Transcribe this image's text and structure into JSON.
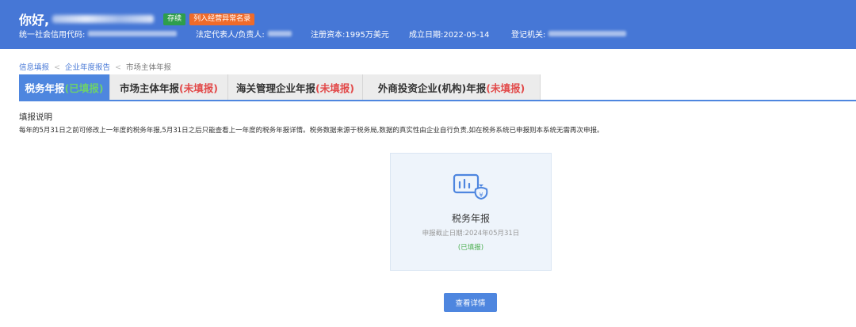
{
  "header": {
    "greeting": "你好,",
    "badges": {
      "status": "存续",
      "abnormal": "列入经营异常名录"
    },
    "credit_code_label": "统一社会信用代码:",
    "legal_rep_label": "法定代表人/负责人:",
    "registered_capital": "注册资本:1995万美元",
    "established_date": "成立日期:2022-05-14",
    "authority_label": "登记机关:"
  },
  "breadcrumb": {
    "item1": "信息填报",
    "item2": "企业年度报告",
    "current": "市场主体年报"
  },
  "tabs": [
    {
      "label": "税务年报",
      "status": "(已填报)",
      "active": true
    },
    {
      "label": "市场主体年报",
      "status": "(未填报)",
      "active": false
    },
    {
      "label": "海关管理企业年报",
      "status": "(未填报)",
      "active": false
    },
    {
      "label": "外商投资企业(机构)年报",
      "status": "(未填报)",
      "active": false
    }
  ],
  "instructions": {
    "title": "填报说明",
    "text": "每年的5月31日之前可修改上一年度的税务年报,5月31日之后只能查看上一年度的税务年报详情。税务数据来源于税务局,数据的真实性由企业自行负责,如在税务系统已申报则本系统无需再次申报。"
  },
  "card": {
    "icon": "tax-report-icon",
    "title": "税务年报",
    "deadline": "申报截止日期:2024年05月31日",
    "status": "(已填报)"
  },
  "button": {
    "label": "查看详情"
  },
  "colors": {
    "header_bg": "#4677d6",
    "accent": "#4e86df",
    "done": "#4caf50",
    "todo": "#e24a4a",
    "badge_green": "#2e9e4b",
    "badge_orange": "#ef6b2a"
  }
}
